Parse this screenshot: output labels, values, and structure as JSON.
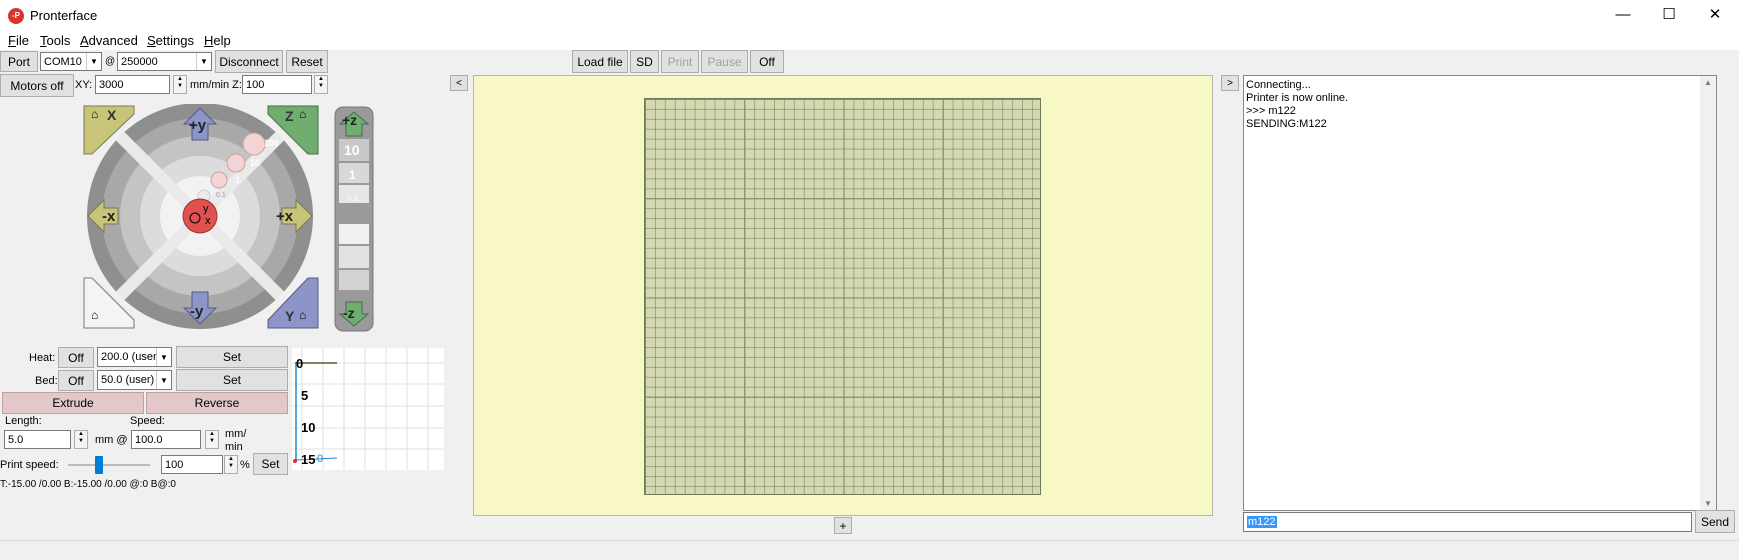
{
  "window": {
    "title": "Pronterface",
    "icon_text": "-P",
    "controls": {
      "minimize": "—",
      "maximize": "☐",
      "close": "✕"
    }
  },
  "menu": {
    "items": [
      {
        "label": "File",
        "accel": "F",
        "rest": "ile"
      },
      {
        "label": "Tools",
        "accel": "T",
        "rest": "ools"
      },
      {
        "label": "Advanced",
        "accel": "A",
        "rest": "dvanced"
      },
      {
        "label": "Settings",
        "accel": "S",
        "rest": "ettings"
      },
      {
        "label": "Help",
        "accel": "H",
        "rest": "elp"
      }
    ]
  },
  "connection": {
    "port_label": "Port",
    "port_value": "COM10",
    "at_symbol": "@",
    "baud_value": "250000",
    "disconnect_label": "Disconnect",
    "reset_label": "Reset"
  },
  "toolbar": {
    "load_file_label": "Load file",
    "sd_label": "SD",
    "print_label": "Print",
    "pause_label": "Pause",
    "off_label": "Off"
  },
  "motion": {
    "motors_off_label": "Motors off",
    "xy_label": "XY:",
    "xy_feed": "3000",
    "z_label": "mm/min Z:",
    "z_feed": "100"
  },
  "jog": {
    "plus_y": "+y",
    "minus_y": "-y",
    "plus_x": "+x",
    "minus_x": "-x",
    "home_x": "X",
    "home_z": "Z",
    "home_y": "Y",
    "center_y": "y",
    "center_x": "x",
    "step_labels": [
      "100",
      "10",
      "1",
      "0.1"
    ],
    "z_plus": "+z",
    "z_minus": "-z",
    "z_steps": [
      "10",
      "1",
      "0.1"
    ]
  },
  "temps": {
    "heat_label": "Heat:",
    "heat_off": "Off",
    "heat_value": "200.0 (user",
    "heat_set": "Set",
    "bed_label": "Bed:",
    "bed_off": "Off",
    "bed_value": "50.0 (user)",
    "bed_set": "Set"
  },
  "extrude": {
    "extrude_label": "Extrude",
    "reverse_label": "Reverse",
    "length_label": "Length:",
    "length_value": "5.0",
    "mm_at": "mm @",
    "speed_label": "Speed:",
    "speed_value": "100.0",
    "speed_unit_1": "mm/",
    "speed_unit_2": "min"
  },
  "print_speed": {
    "label": "Print speed:",
    "value": "100",
    "percent": "%",
    "set_label": "Set"
  },
  "temp_status": "T:-15.00 /0.00 B:-15.00 /0.00 @:0 B@:0",
  "graph": {
    "y_ticks": [
      "0",
      "5",
      "10",
      "15"
    ],
    "overlay": "0"
  },
  "collapse": {
    "left_toggle": "<",
    "right_toggle": ">",
    "plater_add": "+"
  },
  "log": {
    "lines": [
      "Connecting...",
      "Printer is now online.",
      ">>> m122",
      "SENDING:M122"
    ]
  },
  "command": {
    "value": "m122",
    "send_label": "Send"
  },
  "colors": {
    "home_yellow": "#c8c47a",
    "home_green": "#6fae6f",
    "home_blue": "#8c94c8",
    "axis_blue": "#8c94c8",
    "axis_yellow": "#c8c47a",
    "center_red": "#e0524f",
    "plater_bg": "#f8f8c6",
    "bed_grid": "#d4d9b2"
  }
}
